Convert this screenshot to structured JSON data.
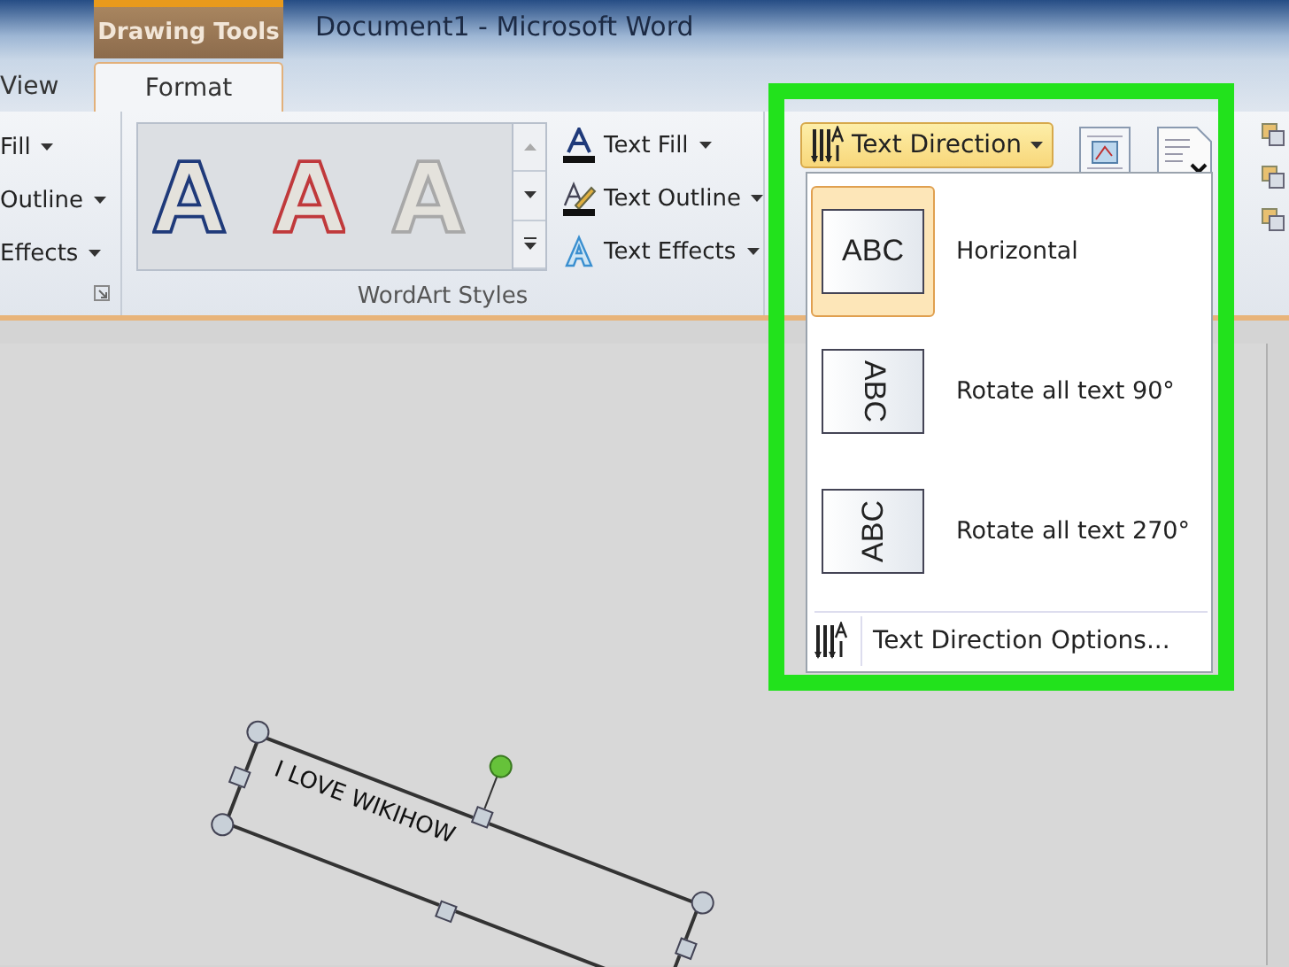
{
  "window": {
    "title": "Document1 - Microsoft Word"
  },
  "contextual_tab": {
    "label": "Drawing Tools"
  },
  "tabs": [
    {
      "label": "View",
      "selected": false
    },
    {
      "label": "Format",
      "selected": true
    }
  ],
  "shape_styles": {
    "commands": [
      {
        "label": "Fill"
      },
      {
        "label": "Outline"
      },
      {
        "label": "Effects"
      }
    ]
  },
  "wordart_styles": {
    "label": "WordArt Styles",
    "styles": [
      {
        "color": "#1f3a7a"
      },
      {
        "color": "#c0393b"
      },
      {
        "color": "#a8a8a8"
      }
    ],
    "commands": [
      {
        "kind": "fill",
        "label": "Text Fill"
      },
      {
        "kind": "outline",
        "label": "Text Outline"
      },
      {
        "kind": "effects",
        "label": "Text Effects"
      }
    ]
  },
  "text_direction_button": {
    "label": "Text Direction",
    "expanded": true
  },
  "text_direction_menu": {
    "items": [
      {
        "kind": "horizontal",
        "preview": "ABC",
        "label": "Horizontal",
        "selected": true
      },
      {
        "kind": "rotate90",
        "preview": "ABC",
        "label": "Rotate all text 90°",
        "selected": false
      },
      {
        "kind": "rotate270",
        "preview": "ABC",
        "label": "Rotate all text 270°",
        "selected": false
      }
    ],
    "footer": "Text Direction Options..."
  },
  "canvas": {
    "text_box": {
      "text": "I LOVE WIKIHOW",
      "selected": true
    }
  }
}
